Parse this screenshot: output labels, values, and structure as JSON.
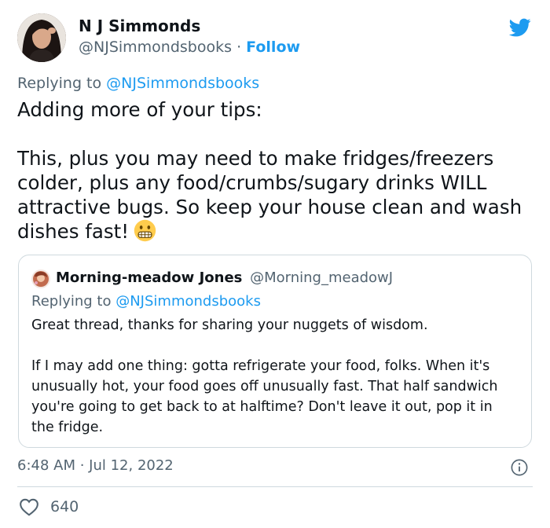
{
  "author": {
    "name": "N J Simmonds",
    "handle": "@NJSimmondsbooks",
    "separator": "·",
    "follow_label": "Follow"
  },
  "reply": {
    "prefix": "Replying to",
    "mention": "@NJSimmondsbooks"
  },
  "tweet": {
    "text": "Adding more of your tips:\n\nThis, plus you may need to make fridges/freezers colder, plus any food/crumbs/sugary drinks WILL attractive bugs. So keep your house clean and wash dishes fast!",
    "emoji": "grimacing-face"
  },
  "quoted": {
    "name": "Morning-meadow Jones",
    "handle": "@Morning_meadowJ",
    "reply_prefix": "Replying to",
    "reply_mention": "@NJSimmondsbooks",
    "text": "Great thread, thanks for sharing your nuggets of wisdom.\n\nIf I may add one thing: gotta refrigerate your food, folks. When it's unusually hot, your food goes off unusually fast. That half sandwich you're going to get back to at halftime? Don't leave it out, pop it in the fridge."
  },
  "meta": {
    "timestamp": "6:48 AM · Jul 12, 2022"
  },
  "engagement": {
    "likes": "640"
  },
  "colors": {
    "accent": "#1d9bf0",
    "secondary_text": "#536471",
    "border": "#cfd9de"
  }
}
